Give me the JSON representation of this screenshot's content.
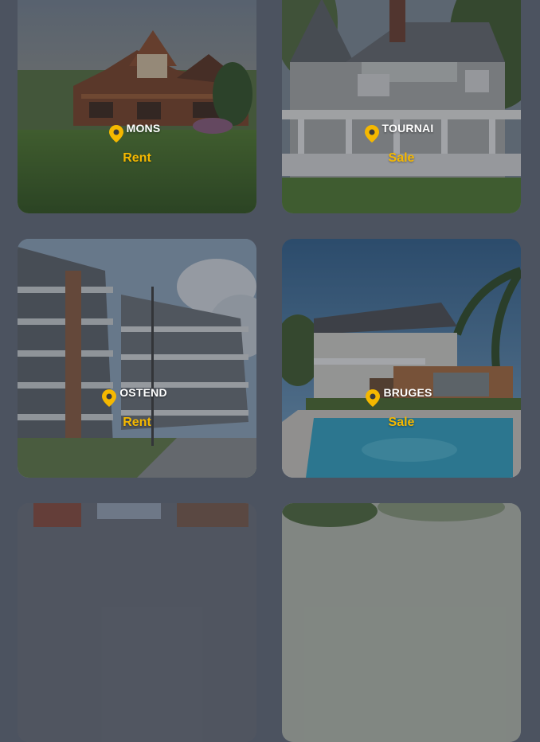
{
  "listings": [
    {
      "city": "MONS",
      "type": "Rent",
      "scene": "log-cabin-house"
    },
    {
      "city": "TOURNAI",
      "type": "Sale",
      "scene": "white-farmhouse"
    },
    {
      "city": "OSTEND",
      "type": "Rent",
      "scene": "apartment-blocks"
    },
    {
      "city": "BRUGES",
      "type": "Sale",
      "scene": "pool-villa"
    },
    {
      "city": "",
      "type": "",
      "scene": "partial-card"
    },
    {
      "city": "",
      "type": "",
      "scene": "partial-card"
    }
  ],
  "colors": {
    "background": "#4c5360",
    "accent": "#f5b800",
    "pin": "#f5b800"
  },
  "icons": {
    "location": "map-pin-icon"
  }
}
